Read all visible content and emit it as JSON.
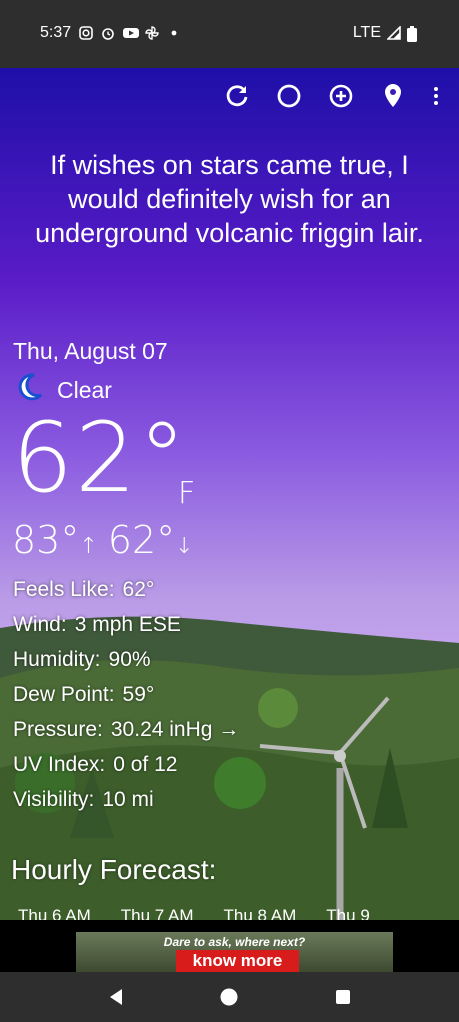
{
  "status": {
    "time": "5:37",
    "icons_left": [
      "instagram-icon",
      "alarm-icon",
      "youtube-icon",
      "pinwheel-icon",
      "dot-icon"
    ],
    "network": "LTE",
    "icons_right": [
      "signal-icon",
      "battery-icon"
    ]
  },
  "toolbar": {
    "items": [
      "refresh-icon",
      "theme-icon",
      "add-icon",
      "location-icon",
      "more-icon"
    ]
  },
  "quote": "If wishes on stars came true, I would definitely wish for an underground volcanic friggin lair.",
  "weather": {
    "date": "Thu, August 07",
    "condition": "Clear",
    "condition_icon": "moon-icon",
    "temp": "62°",
    "unit": "F",
    "high": "83°",
    "low": "62°",
    "details": [
      {
        "label": "Feels Like:",
        "value": "62°"
      },
      {
        "label": "Wind:",
        "value": "3 mph ESE"
      },
      {
        "label": "Humidity:",
        "value": "90%"
      },
      {
        "label": "Dew Point:",
        "value": "59°"
      },
      {
        "label": "Pressure:",
        "value": "30.24 inHg →"
      },
      {
        "label": "UV Index:",
        "value": "0 of 12"
      },
      {
        "label": "Visibility:",
        "value": "10 mi"
      }
    ]
  },
  "hourly": {
    "title": "Hourly Forecast:",
    "items": [
      "Thu 6 AM",
      "Thu 7 AM",
      "Thu 8 AM",
      "Thu 9"
    ]
  },
  "ad": {
    "tagline": "Dare to ask, where next?",
    "button": "know more"
  },
  "colors": {
    "sky_top": "#1e0fa8",
    "sky_mid": "#8a5ae0",
    "accent_ad": "#d81c1c",
    "bars": "#2e2e2e"
  }
}
